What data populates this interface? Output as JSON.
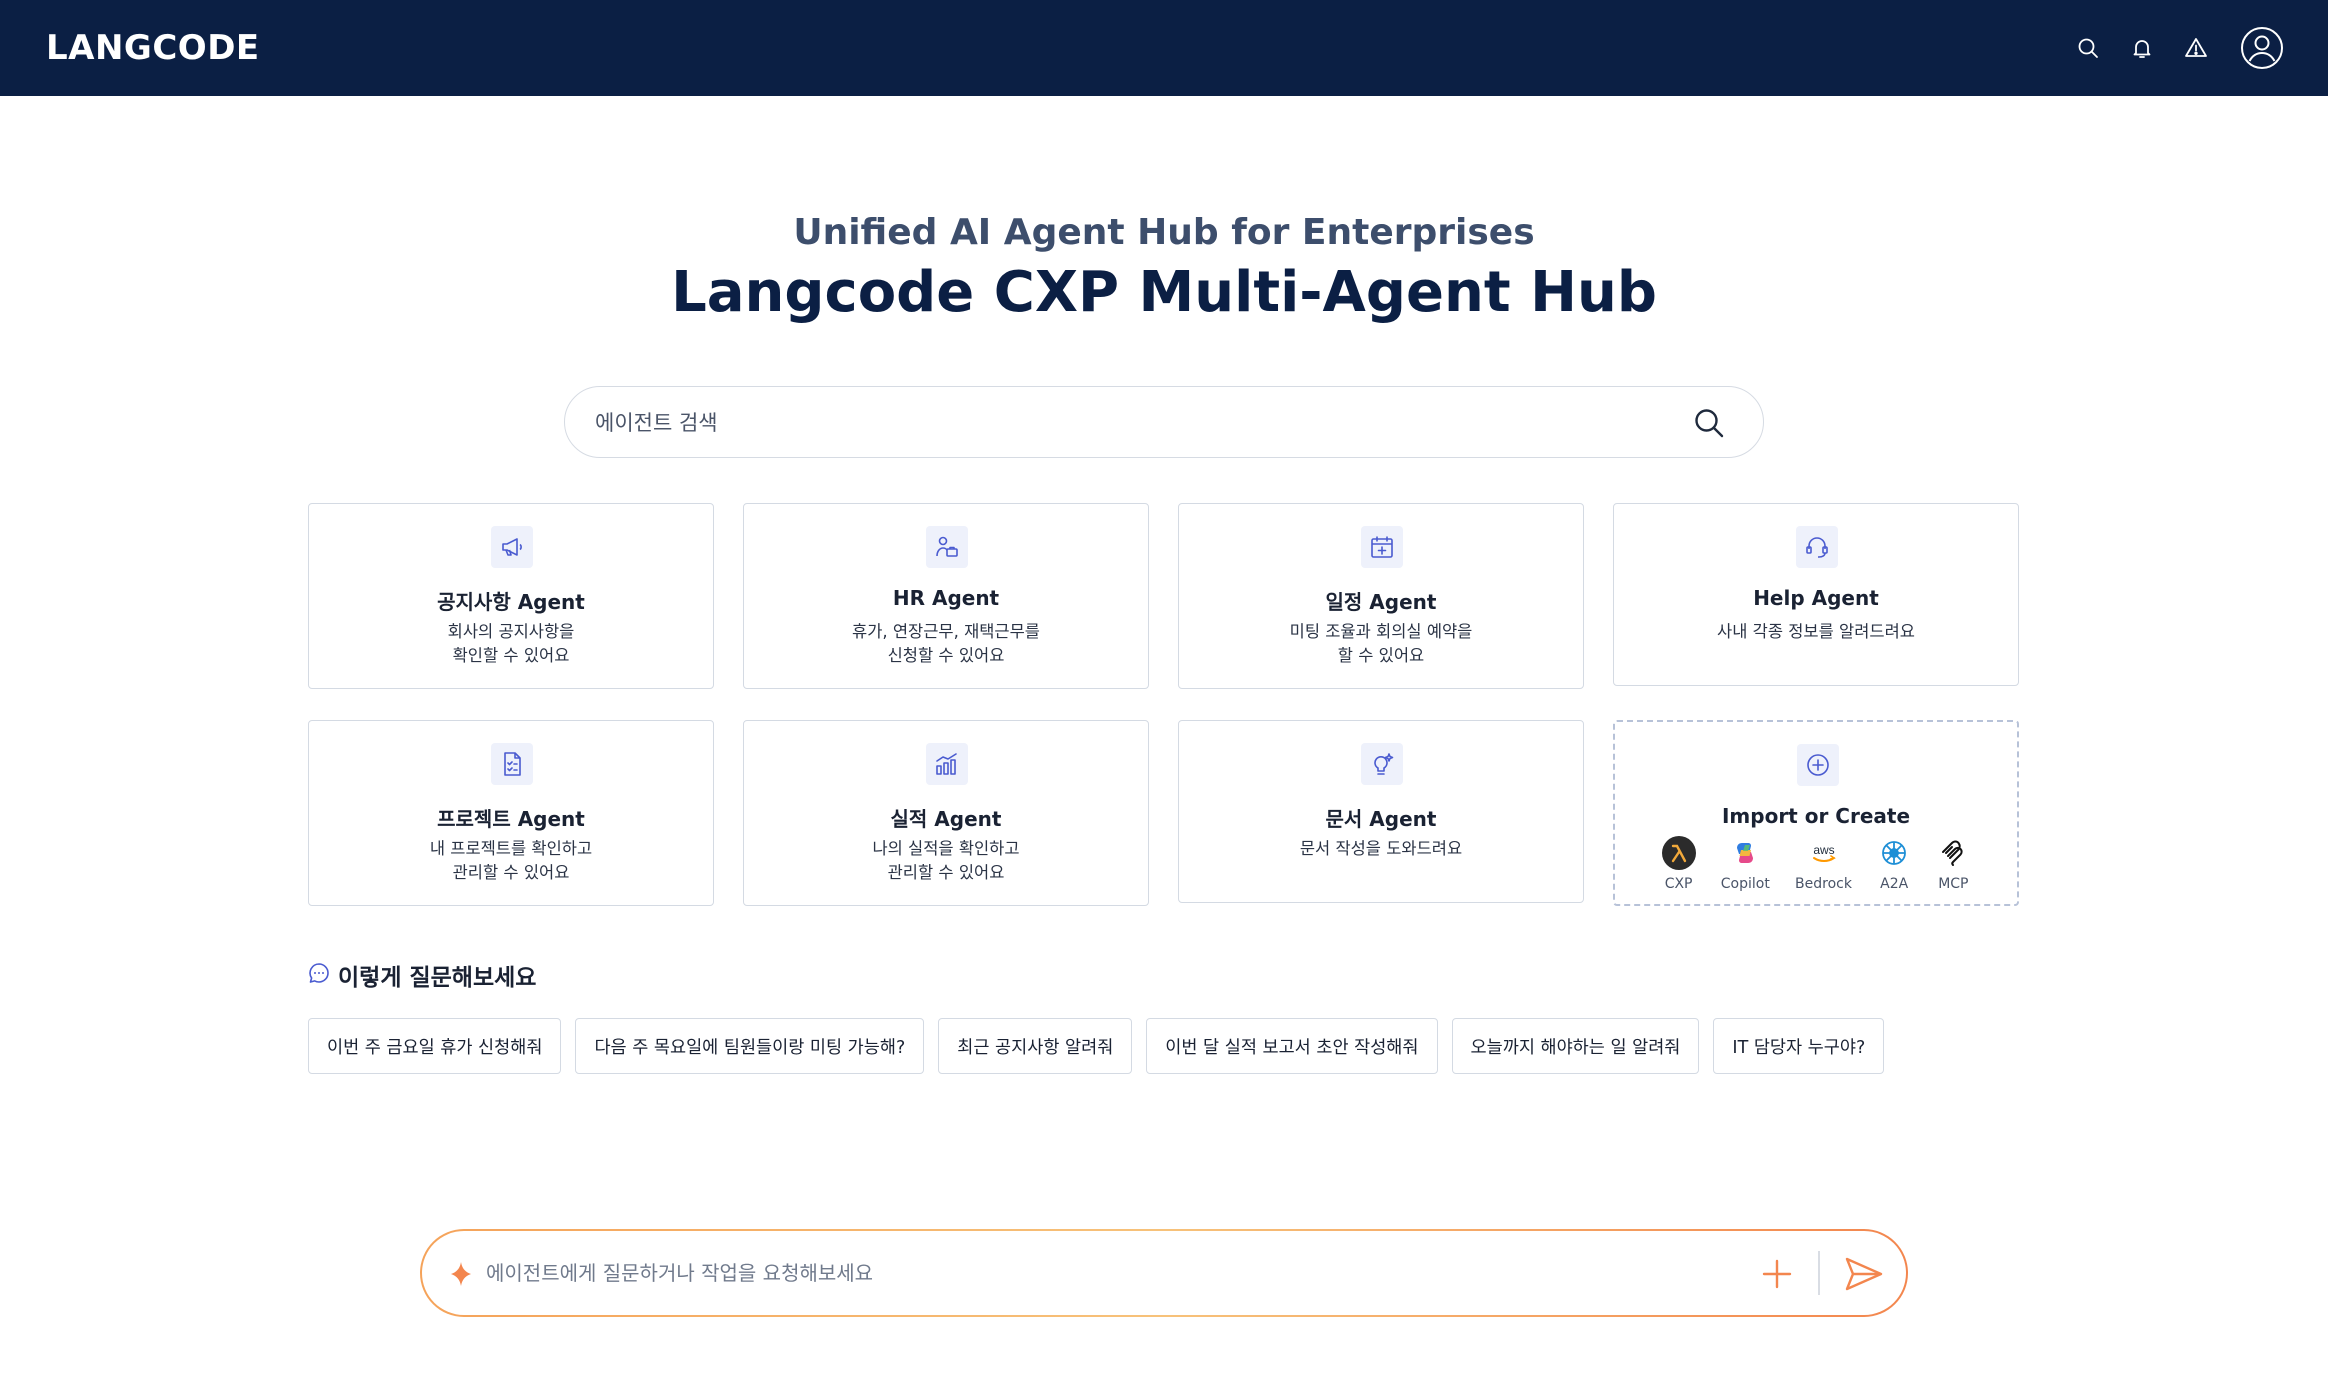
{
  "header": {
    "brand": "LANGCODE",
    "icons": [
      "search-icon",
      "bell-icon",
      "alert-icon",
      "user-icon"
    ]
  },
  "hero": {
    "subtitle": "Unified AI Agent Hub for Enterprises",
    "title": "Langcode CXP Multi-Agent Hub"
  },
  "search": {
    "placeholder": "에이전트 검색"
  },
  "agents": [
    {
      "name": "공지사항 Agent",
      "desc1": "회사의 공지사항을",
      "desc2": "확인할 수 있어요",
      "icon": "megaphone-icon"
    },
    {
      "name": "HR Agent",
      "desc1": "휴가, 연장근무, 재택근무를",
      "desc2": "신청할 수 있어요",
      "icon": "person-briefcase-icon"
    },
    {
      "name": "일정 Agent",
      "desc1": "미팅 조율과 회의실 예약을",
      "desc2": "할 수 있어요",
      "icon": "calendar-plus-icon"
    },
    {
      "name": "Help Agent",
      "desc1": "사내 각종 정보를 알려드려요",
      "desc2": "",
      "icon": "headset-icon"
    },
    {
      "name": "프로젝트 Agent",
      "desc1": "내 프로젝트를 확인하고",
      "desc2": "관리할 수 있어요",
      "icon": "checklist-document-icon"
    },
    {
      "name": "실적 Agent",
      "desc1": "나의 실적을 확인하고",
      "desc2": "관리할 수 있어요",
      "icon": "bar-chart-icon"
    },
    {
      "name": "문서 Agent",
      "desc1": "문서 작성을 도와드려요",
      "desc2": "",
      "icon": "lightbulb-sparkle-icon"
    }
  ],
  "import_card": {
    "name": "Import or Create",
    "icon": "plus-circle-icon",
    "providers": [
      {
        "label": "CXP",
        "icon": "lambda-icon"
      },
      {
        "label": "Copilot",
        "icon": "copilot-icon"
      },
      {
        "label": "Bedrock",
        "icon": "aws-icon"
      },
      {
        "label": "A2A",
        "icon": "a2a-icon"
      },
      {
        "label": "MCP",
        "icon": "mcp-icon"
      }
    ]
  },
  "suggestions": {
    "title": "이렇게 질문해보세요",
    "items": [
      "이번 주 금요일 휴가 신청해줘",
      "다음 주 목요일에 팀원들이랑 미팅 가능해?",
      "최근 공지사항 알려줘",
      "이번 달 실적 보고서 초안 작성해줘",
      "오늘까지 해야하는 일 알려줘",
      "IT 담당자 누구야?"
    ]
  },
  "chat": {
    "placeholder": "에이전트에게 질문하거나 작업을 요청해보세요"
  },
  "colors": {
    "header_bg": "#0b1f44",
    "accent": "#4a5bd0",
    "chat_gradient": [
      "#f5a35a",
      "#f3864e"
    ]
  }
}
